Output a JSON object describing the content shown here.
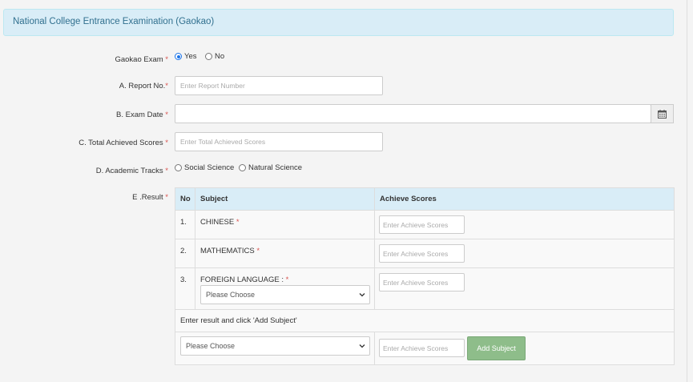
{
  "header": {
    "title": "National College Entrance Examination (Gaokao)"
  },
  "form": {
    "gaokao": {
      "label": "Gaokao Exam",
      "req": "*",
      "options": [
        "Yes",
        "No"
      ],
      "selected": "Yes"
    },
    "report": {
      "label": "A. Report No.",
      "req": "*",
      "placeholder": "Enter Report Number"
    },
    "exam_date": {
      "label": "B. Exam Date",
      "req": "*",
      "value": ""
    },
    "total": {
      "label": "C. Total Achieved Scores",
      "req": "*",
      "placeholder": "Enter Total Achieved Scores"
    },
    "tracks": {
      "label": "D. Academic Tracks",
      "req": "*",
      "options": [
        "Social Science",
        "Natural Science"
      ]
    },
    "result": {
      "label": "E .Result",
      "req": "*"
    }
  },
  "table": {
    "headers": {
      "no": "No",
      "subject": "Subject",
      "scores": "Achieve Scores"
    },
    "rows": [
      {
        "no": "1.",
        "subject": "CHINESE",
        "req": "*",
        "placeholder": "Enter Achieve Scores"
      },
      {
        "no": "2.",
        "subject": "MATHEMATICS",
        "req": "*",
        "placeholder": "Enter Achieve Scores"
      },
      {
        "no": "3.",
        "subject": "FOREIGN LANGUAGE :",
        "req": "*",
        "placeholder": "Enter Achieve Scores",
        "select": "Please Choose"
      }
    ],
    "instruction": "Enter result and click 'Add Subject'",
    "add_row": {
      "select": "Please Choose",
      "placeholder": "Enter Achieve Scores",
      "button": "Add Subject"
    }
  },
  "colors": {
    "header_bg": "#d9edf7",
    "header_text": "#31708f",
    "required": "#d9534f",
    "add_button": "#8ebd8a"
  }
}
